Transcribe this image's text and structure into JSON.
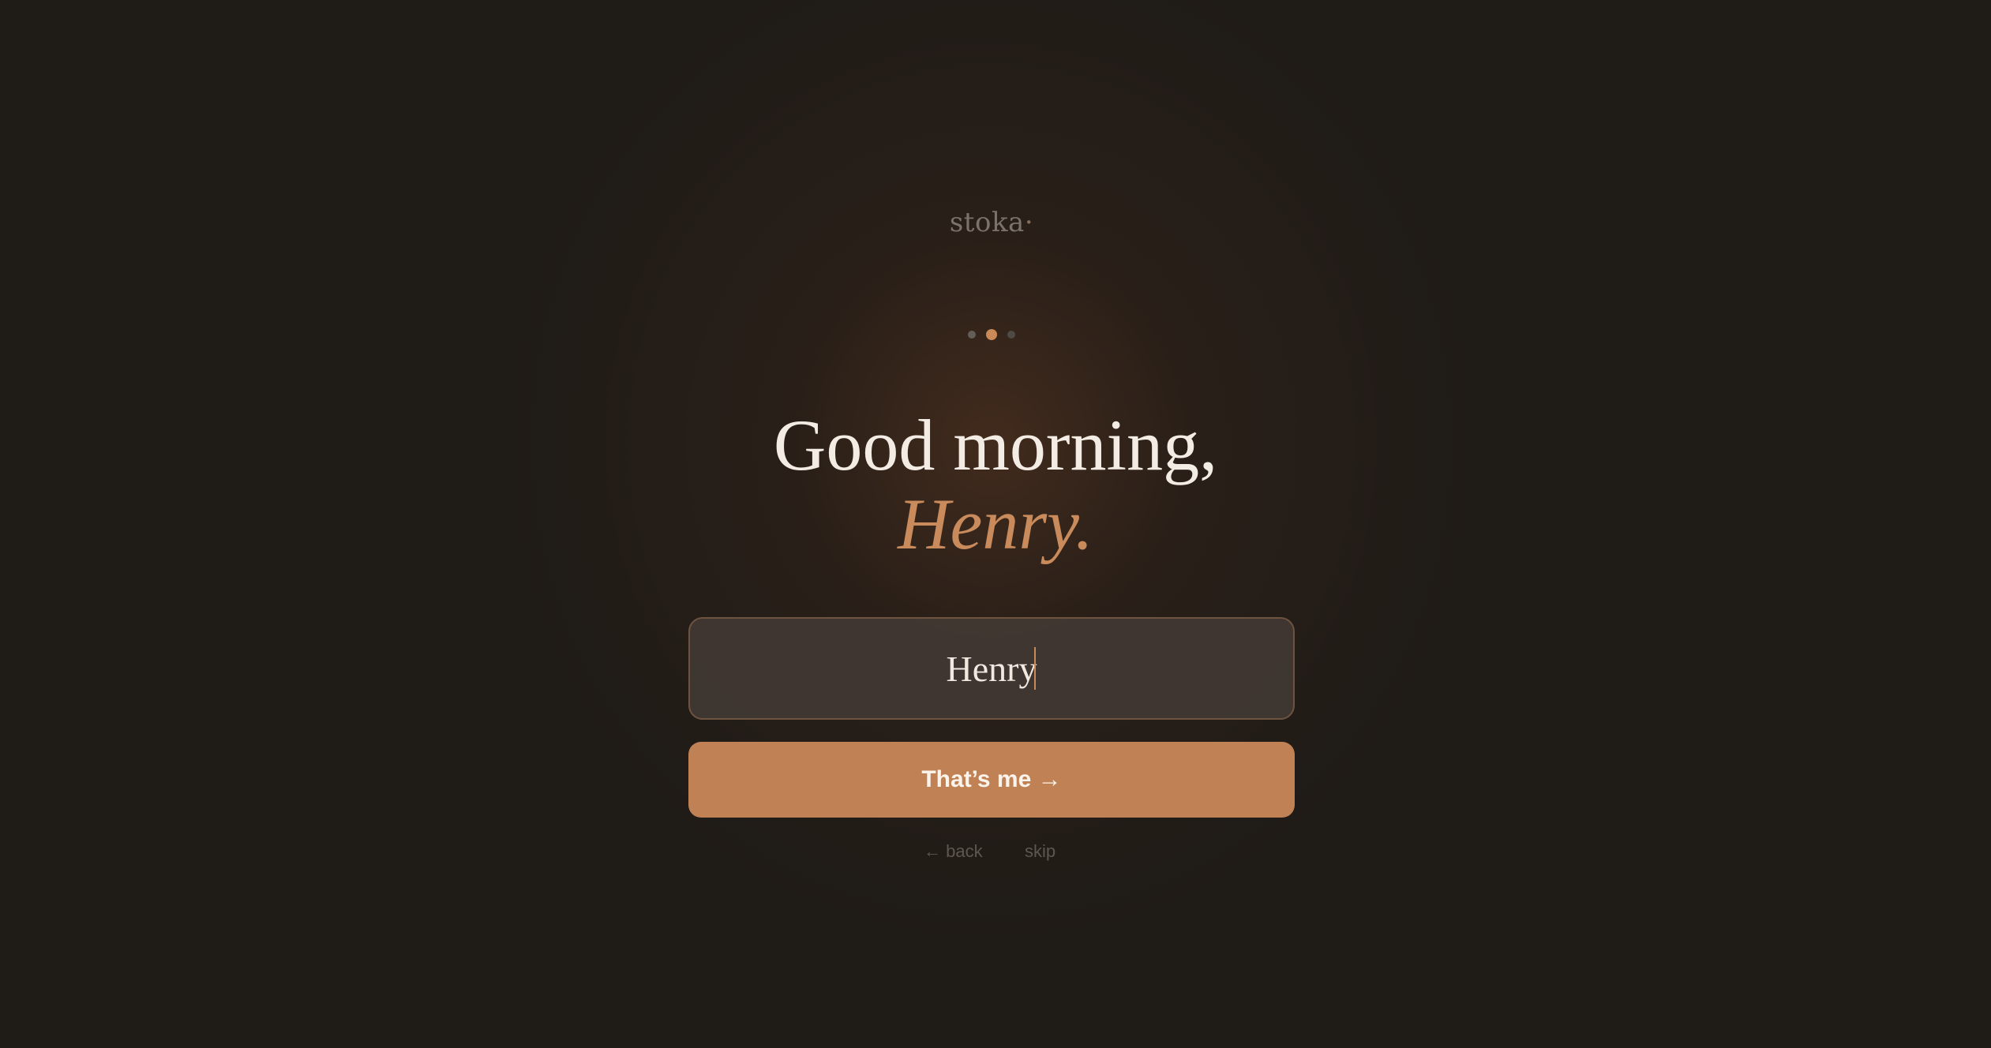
{
  "brand": {
    "name": "stoka",
    "mark": "·"
  },
  "progress": {
    "total_steps": 3,
    "current_step": 2
  },
  "greeting": {
    "line1": "Good morning,",
    "name_line": "Henry."
  },
  "name_input": {
    "value": "Henry",
    "placeholder": ""
  },
  "actions": {
    "confirm_label": "That’s me →",
    "back_label": "← back",
    "skip_label": "skip"
  },
  "colors": {
    "background": "#1f1b17",
    "accent": "#c08254",
    "text": "#f3ece4",
    "muted": "#5e5750"
  }
}
